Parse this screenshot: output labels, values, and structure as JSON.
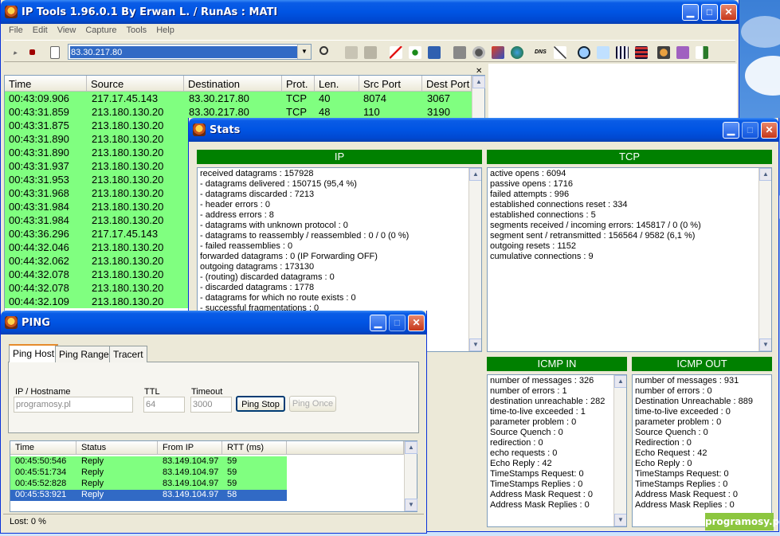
{
  "main": {
    "title": "IP Tools 1.96.0.1 By Erwan L. / RunAs : MATI",
    "menu": [
      "File",
      "Edit",
      "View",
      "Capture",
      "Tools",
      "Help"
    ],
    "address": "83.30.217.80",
    "columns": [
      "Time",
      "Source",
      "Destination",
      "Prot.",
      "Len.",
      "Src Port",
      "Dest Port"
    ],
    "rows": [
      [
        "00:43:09.906",
        "217.17.45.143",
        "83.30.217.80",
        "TCP",
        "40",
        "8074",
        "3067"
      ],
      [
        "00:43:31.859",
        "213.180.130.20",
        "83.30.217.80",
        "TCP",
        "48",
        "110",
        "3190"
      ],
      [
        "00:43:31.875",
        "213.180.130.20"
      ],
      [
        "00:43:31.890",
        "213.180.130.20"
      ],
      [
        "00:43:31.890",
        "213.180.130.20"
      ],
      [
        "00:43:31.937",
        "213.180.130.20"
      ],
      [
        "00:43:31.953",
        "213.180.130.20"
      ],
      [
        "00:43:31.968",
        "213.180.130.20"
      ],
      [
        "00:43:31.984",
        "213.180.130.20"
      ],
      [
        "00:43:31.984",
        "213.180.130.20"
      ],
      [
        "00:43:36.296",
        "217.17.45.143"
      ],
      [
        "00:44:32.046",
        "213.180.130.20"
      ],
      [
        "00:44:32.062",
        "213.180.130.20"
      ],
      [
        "00:44:32.078",
        "213.180.130.20"
      ],
      [
        "00:44:32.078",
        "213.180.130.20"
      ],
      [
        "00:44:32.109",
        "213.180.130.20"
      ]
    ]
  },
  "stats": {
    "title": "Stats",
    "ip_header": "IP",
    "tcp_header": "TCP",
    "icmp_in_header": "ICMP IN",
    "icmp_out_header": "ICMP OUT",
    "ip": [
      "received datagrams : 157928",
      "- datagrams delivered : 150715 (95,4 %)",
      "- datagrams discarded : 7213",
      "- header errors : 0",
      "- address errors : 8",
      "- datagrams with unknown protocol : 0",
      "- datagrams to reassembly / reassembled : 0 / 0 (0 %)",
      "- failed reassemblies : 0",
      "forwarded datagrams : 0 (IP Forwarding OFF)",
      "outgoing datagrams : 173130",
      "- (routing) discarded datagrams : 0",
      "- discarded datagrams : 1778",
      "- datagrams for which no route exists : 0",
      "- successful fragmentations : 0"
    ],
    "tcp": [
      "active opens : 6094",
      "passive opens : 1716",
      "failed attempts : 996",
      "established connections reset : 334",
      "established connections : 5",
      "segments received  / incoming errors: 145817 / 0 (0 %)",
      "segment sent / retransmitted : 156564 / 9582 (6,1 %)",
      "outgoing resets : 1152",
      "cumulative connections : 9"
    ],
    "icmp_in": [
      "number of messages : 326",
      "number of errors : 1",
      "destination unreachable : 282",
      "time-to-live exceeded : 1",
      "parameter problem : 0",
      "Source Quench : 0",
      "redirection : 0",
      "echo requests : 0",
      "Echo Reply : 42",
      "TimeStamps Request: 0",
      "TimeStamps Replies : 0",
      "Address Mask Request : 0",
      "Address Mask Replies : 0"
    ],
    "icmp_out": [
      "number of messages : 931",
      "number of errors : 0",
      "Destination Unreachable : 889",
      "time-to-live exceeded : 0",
      "parameter problem : 0",
      "Source Quench : 0",
      "Redirection : 0",
      "Echo Request : 42",
      "Echo Reply : 0",
      "TimeStamps Request: 0",
      "TimeStamps Replies : 0",
      "Address Mask Request : 0",
      "Address Mask Replies : 0"
    ]
  },
  "ping": {
    "title": "PING",
    "tabs": [
      "Ping Host",
      "Ping Range",
      "Tracert"
    ],
    "host_label": "IP / Hostname",
    "ttl_label": "TTL",
    "timeout_label": "Timeout",
    "host_value": "programosy.pl",
    "ttl_value": "64",
    "timeout_value": "3000",
    "stop_button": "Ping Stop",
    "once_button": "Ping Once",
    "columns": [
      "Time",
      "Status",
      "From IP",
      "RTT (ms)"
    ],
    "rows": [
      [
        "00:45:50:546",
        "Reply",
        "83.149.104.97",
        "59"
      ],
      [
        "00:45:51:734",
        "Reply",
        "83.149.104.97",
        "59"
      ],
      [
        "00:45:52:828",
        "Reply",
        "83.149.104.97",
        "59"
      ],
      [
        "00:45:53:921",
        "Reply",
        "83.149.104.97",
        "58"
      ]
    ],
    "status": "Lost: 0 %"
  },
  "watermark": "programosy.pl",
  "colors": {
    "row_green": "#80ff80",
    "header_green": "#008000",
    "selection": "#316ac5"
  }
}
